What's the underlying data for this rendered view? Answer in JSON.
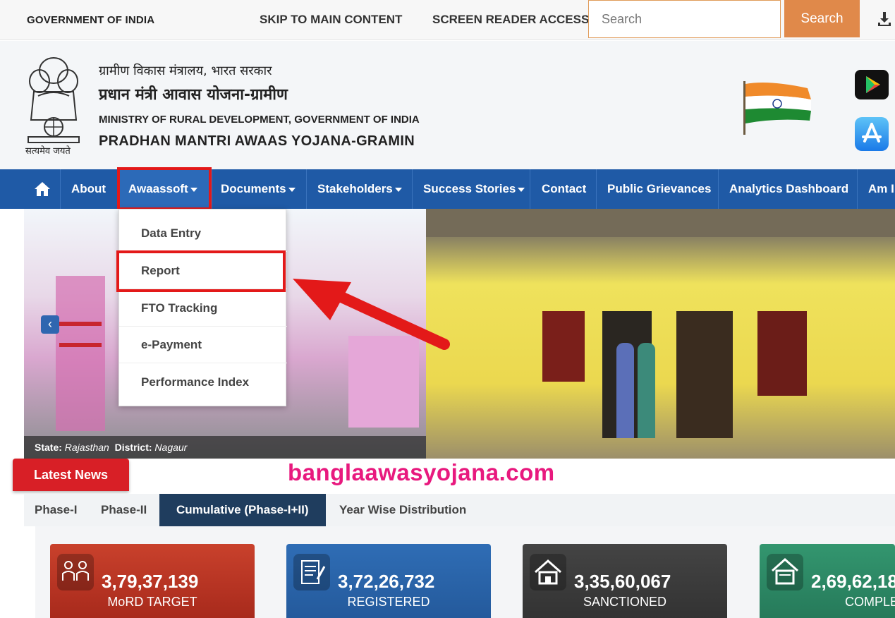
{
  "topbar": {
    "gov_label": "GOVERNMENT OF INDIA",
    "skip_link": "SKIP TO MAIN CONTENT",
    "screen_reader_link": "SCREEN READER ACCESS",
    "search_placeholder": "Search",
    "search_button": "Search"
  },
  "header": {
    "line1_hindi": "ग्रामीण विकास मंत्रालय, भारत सरकार",
    "line2_hindi": "प्रधान मंत्री आवास योजना-ग्रामीण",
    "line3": "MINISTRY OF RURAL DEVELOPMENT, GOVERNMENT OF INDIA",
    "line4": "PRADHAN MANTRI AWAAS YOJANA-GRAMIN",
    "emblem_motto": "सत्यमेव जयते"
  },
  "nav": {
    "items": [
      "About",
      "Awaassoft",
      "Documents",
      "Stakeholders",
      "Success Stories",
      "Contact",
      "Public Grievances",
      "Analytics Dashboard",
      "Am I"
    ]
  },
  "dropdown": {
    "items": [
      "Data Entry",
      "Report",
      "FTO Tracking",
      "e-Payment",
      "Performance Index"
    ]
  },
  "slider": {
    "state_label": "State:",
    "state_value": "Rajasthan",
    "district_label": "District:",
    "district_value": "Nagaur"
  },
  "news": {
    "label": "Latest News",
    "watermark": "banglaawasyojana.com"
  },
  "tabs": [
    "Phase-I",
    "Phase-II",
    "Cumulative (Phase-I+II)",
    "Year Wise Distribution"
  ],
  "stats": [
    {
      "value": "3,79,37,139",
      "label": "MoRD TARGET",
      "color": "#c0392b"
    },
    {
      "value": "3,72,26,732",
      "label": "REGISTERED",
      "color": "#2f6db5"
    },
    {
      "value": "3,35,60,067",
      "label": "SANCTIONED",
      "color": "#3d3d3d"
    },
    {
      "value": "2,69,62,18",
      "label": "COMPLETED",
      "color": "#2e8b6e"
    }
  ],
  "colors": {
    "nav_blue": "#1f5aa6",
    "search_orange": "#e0894a",
    "highlight_red": "#e31919",
    "news_red": "#d81f26",
    "watermark_pink": "#e8197e"
  }
}
